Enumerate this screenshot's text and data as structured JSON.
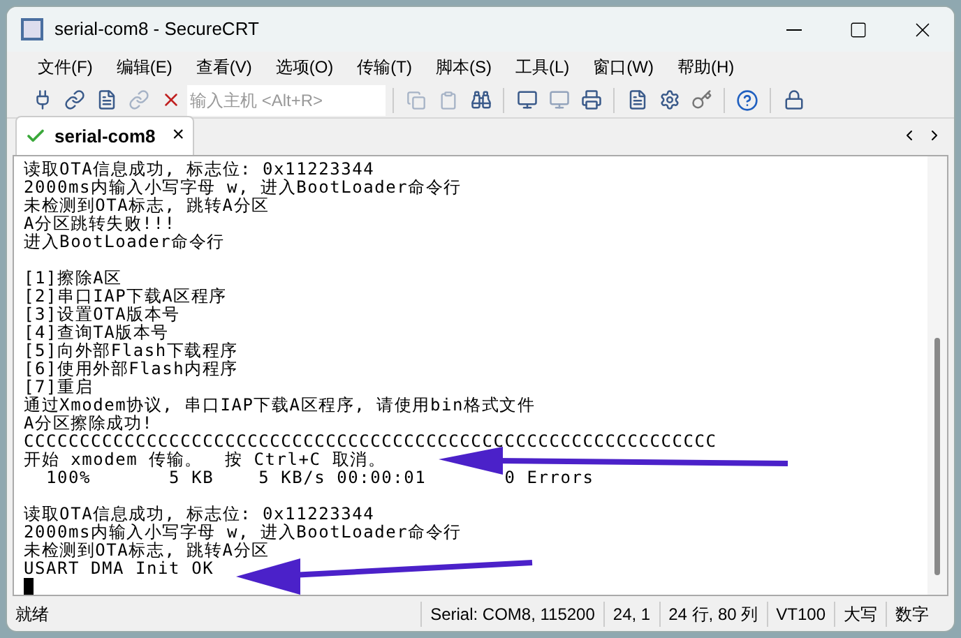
{
  "window": {
    "title": "serial-com8 - SecureCRT"
  },
  "menu": [
    "文件(F)",
    "编辑(E)",
    "查看(V)",
    "选项(O)",
    "传输(T)",
    "脚本(S)",
    "工具(L)",
    "窗口(W)",
    "帮助(H)"
  ],
  "toolbar": {
    "host_field": {
      "placeholder": "输入主机 <Alt+R>"
    }
  },
  "tabs": [
    {
      "label": "serial-com8",
      "selected": true,
      "connected": true,
      "close": "×"
    }
  ],
  "terminal": {
    "blocks": [
      [
        "读取OTA信息成功, 标志位: 0x11223344",
        "2000ms内输入小写字母 w, 进入BootLoader命令行",
        "未检测到OTA标志, 跳转A分区",
        "A分区跳转失败!!!",
        "进入BootLoader命令行"
      ],
      [
        "[1]擦除A区",
        "[2]串口IAP下载A区程序",
        "[3]设置OTA版本号",
        "[4]查询TA版本号",
        "[5]向外部Flash下载程序",
        "[6]使用外部Flash内程序",
        "[7]重启",
        "通过Xmodem协议, 串口IAP下载A区程序, 请使用bin格式文件",
        "A分区擦除成功!",
        "CCCCCCCCCCCCCCCCCCCCCCCCCCCCCCCCCCCCCCCCCCCCCCCCCCCCCCCCCCCCCC",
        "开始 xmodem 传输。  按 Ctrl+C 取消。",
        "  100%       5 KB    5 KB/s 00:00:01       0 Errors"
      ],
      [
        "读取OTA信息成功, 标志位: 0x11223344",
        "2000ms内输入小写字母 w, 进入BootLoader命令行",
        "未检测到OTA标志, 跳转A分区",
        "USART DMA Init OK"
      ]
    ]
  },
  "status_bar": [
    "就绪",
    "Serial: COM8, 115200",
    "24,   1",
    "24 行, 80 列",
    "VT100",
    "大写",
    "数字"
  ]
}
